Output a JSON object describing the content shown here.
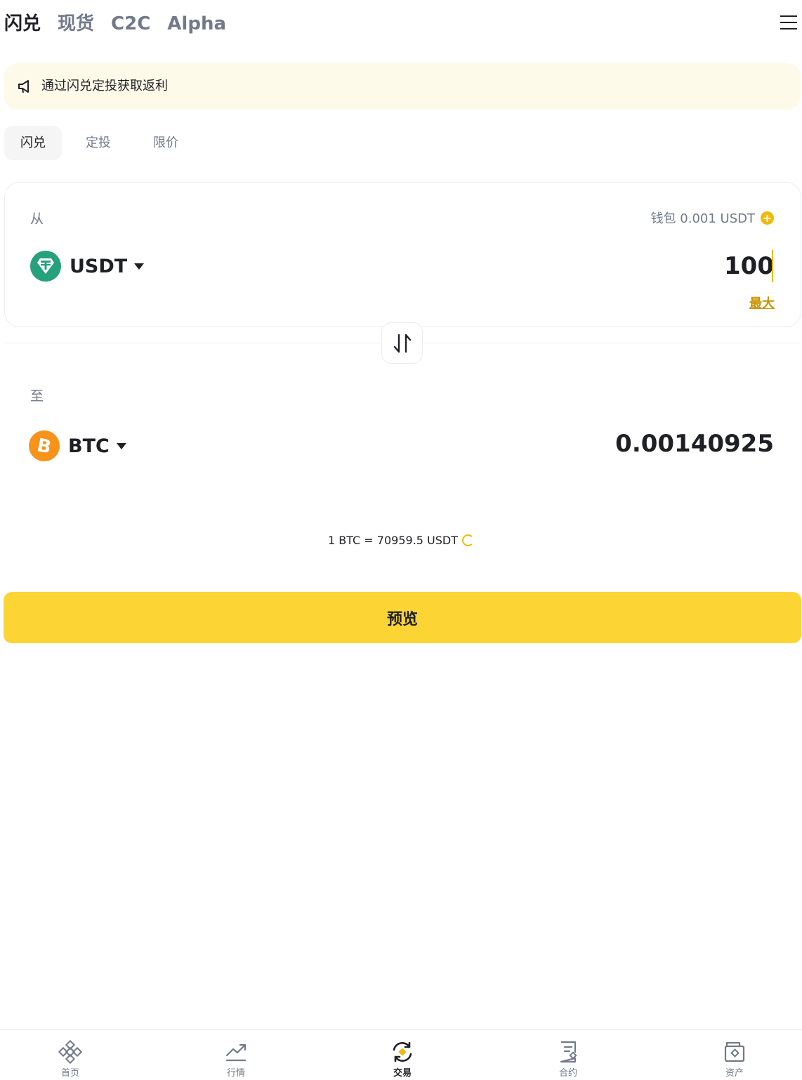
{
  "topnav": {
    "tabs": [
      {
        "label": "闪兑",
        "active": true
      },
      {
        "label": "现货",
        "active": false
      },
      {
        "label": "C2C",
        "active": false
      },
      {
        "label": "Alpha",
        "active": false
      }
    ],
    "menu_icon": "hamburger-menu-icon"
  },
  "banner": {
    "icon": "speaker-icon",
    "text": "通过闪兑定投获取返利"
  },
  "mode_tabs": [
    {
      "label": "闪兑",
      "active": true
    },
    {
      "label": "定投",
      "active": false
    },
    {
      "label": "限价",
      "active": false
    }
  ],
  "from": {
    "label": "从",
    "wallet_label": "钱包 0.001 USDT",
    "coin": "USDT",
    "coin_icon": "usdt-tether-icon",
    "amount": "100",
    "max_label": "最大"
  },
  "to": {
    "label": "至",
    "coin": "BTC",
    "coin_icon": "bitcoin-icon",
    "amount": "0.00140925"
  },
  "rate": "1 BTC = 70959.5 USDT",
  "preview_button": "预览",
  "bottom_nav": [
    {
      "label": "首页",
      "icon": "binance-logo-icon",
      "active": false
    },
    {
      "label": "行情",
      "icon": "market-trend-icon",
      "active": false
    },
    {
      "label": "交易",
      "icon": "trade-exchange-icon",
      "active": true
    },
    {
      "label": "合约",
      "icon": "futures-contract-icon",
      "active": false
    },
    {
      "label": "资产",
      "icon": "wallet-assets-icon",
      "active": false
    }
  ],
  "colors": {
    "accent_yellow": "#fcd535",
    "brand_gold": "#f0b90b",
    "max_link": "#c99400",
    "usdt_green": "#26a17b",
    "btc_orange": "#f7931a",
    "banner_bg": "#fefae9"
  }
}
